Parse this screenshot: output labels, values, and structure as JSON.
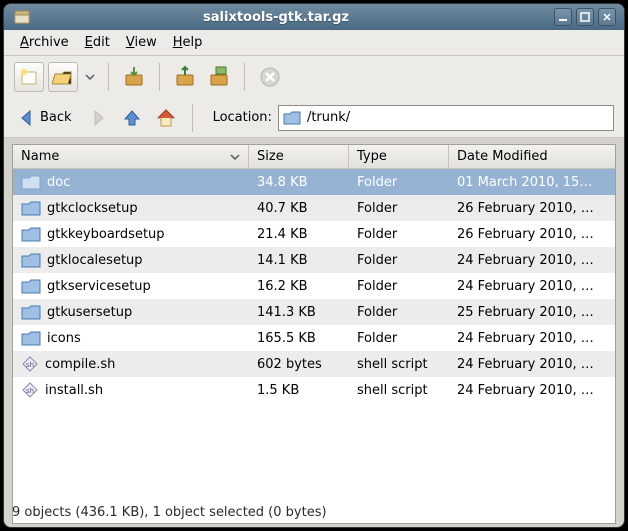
{
  "window": {
    "title": "salixtools-gtk.tar.gz"
  },
  "menu": {
    "archive": "Archive",
    "edit": "Edit",
    "view": "View",
    "help": "Help"
  },
  "location": {
    "label": "Location:",
    "back": "Back",
    "path": "/trunk/"
  },
  "columns": {
    "name": "Name",
    "size": "Size",
    "type": "Type",
    "date": "Date Modified"
  },
  "files": [
    {
      "name": "doc",
      "size": "34.8 KB",
      "type": "Folder",
      "date": "01 March 2010, 15…",
      "icon": "folder",
      "selected": true,
      "alt": false
    },
    {
      "name": "gtkclocksetup",
      "size": "40.7 KB",
      "type": "Folder",
      "date": "26 February 2010, …",
      "icon": "folder",
      "selected": false,
      "alt": true
    },
    {
      "name": "gtkkeyboardsetup",
      "size": "21.4 KB",
      "type": "Folder",
      "date": "26 February 2010, …",
      "icon": "folder",
      "selected": false,
      "alt": false
    },
    {
      "name": "gtklocalesetup",
      "size": "14.1 KB",
      "type": "Folder",
      "date": "24 February 2010, …",
      "icon": "folder",
      "selected": false,
      "alt": true
    },
    {
      "name": "gtkservicesetup",
      "size": "16.2 KB",
      "type": "Folder",
      "date": "24 February 2010, …",
      "icon": "folder",
      "selected": false,
      "alt": false
    },
    {
      "name": "gtkusersetup",
      "size": "141.3 KB",
      "type": "Folder",
      "date": "25 February 2010, …",
      "icon": "folder",
      "selected": false,
      "alt": true
    },
    {
      "name": "icons",
      "size": "165.5 KB",
      "type": "Folder",
      "date": "24 February 2010, …",
      "icon": "folder",
      "selected": false,
      "alt": false
    },
    {
      "name": "compile.sh",
      "size": "602 bytes",
      "type": "shell script",
      "date": "24 February 2010, …",
      "icon": "script",
      "selected": false,
      "alt": true
    },
    {
      "name": "install.sh",
      "size": "1.5 KB",
      "type": "shell script",
      "date": "24 February 2010, …",
      "icon": "script",
      "selected": false,
      "alt": false
    }
  ],
  "status": {
    "text": "9 objects (436.1 KB), 1 object selected (0 bytes)"
  }
}
